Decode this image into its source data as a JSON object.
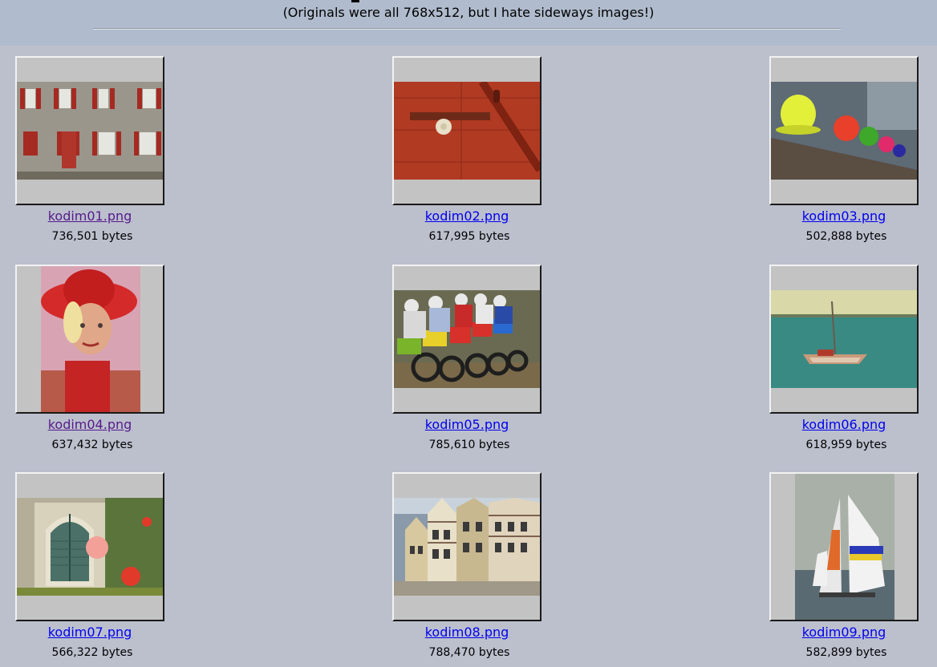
{
  "header": {
    "subtitle": "(Originals were all 768x512, but I hate sideways images!)"
  },
  "gallery": [
    {
      "file": "kodim01.png",
      "size": "736,501 bytes",
      "visited": true
    },
    {
      "file": "kodim02.png",
      "size": "617,995 bytes",
      "visited": false
    },
    {
      "file": "kodim03.png",
      "size": "502,888 bytes",
      "visited": false
    },
    {
      "file": "kodim04.png",
      "size": "637,432 bytes",
      "visited": true
    },
    {
      "file": "kodim05.png",
      "size": "785,610 bytes",
      "visited": false
    },
    {
      "file": "kodim06.png",
      "size": "618,959 bytes",
      "visited": false
    },
    {
      "file": "kodim07.png",
      "size": "566,322 bytes",
      "visited": false
    },
    {
      "file": "kodim08.png",
      "size": "788,470 bytes",
      "visited": false
    },
    {
      "file": "kodim09.png",
      "size": "582,899 bytes",
      "visited": false
    }
  ],
  "colors": {
    "page_background": "#bcc0cd",
    "header_background": "#b0bccd",
    "link_unvisited": "#0000ee",
    "link_visited": "#551a8b",
    "thumb_frame": "#c3c3c3"
  }
}
